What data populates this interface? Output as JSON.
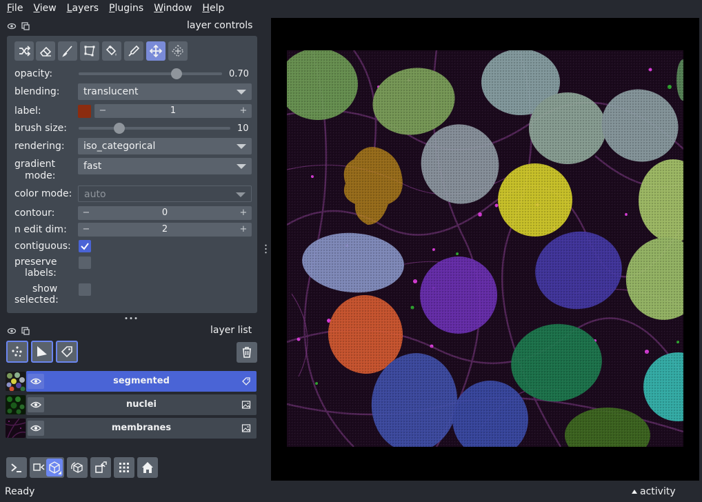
{
  "menu": [
    {
      "label": "File",
      "ul": "F",
      "rest": "ile"
    },
    {
      "label": "View",
      "ul": "V",
      "rest": "iew"
    },
    {
      "label": "Layers",
      "ul": "L",
      "rest": "ayers"
    },
    {
      "label": "Plugins",
      "ul": "P",
      "rest": "lugins"
    },
    {
      "label": "Window",
      "ul": "W",
      "rest": "indow"
    },
    {
      "label": "Help",
      "ul": "H",
      "rest": "elp"
    }
  ],
  "layer_controls": {
    "title": "layer controls",
    "mode_buttons": [
      "shuffle-icon",
      "eraser-icon",
      "paintbrush-icon",
      "polygon-icon",
      "fill-bucket-icon",
      "color-picker-icon",
      "pan-zoom-icon",
      "transform-icon"
    ],
    "active_mode": "pan-zoom-icon",
    "opacity": {
      "label": "opacity:",
      "value": "0.70",
      "fraction": 0.7
    },
    "blending": {
      "label": "blending:",
      "value": "translucent"
    },
    "label": {
      "label": "label:",
      "value": "1",
      "swatch_color": "#8b2c0f"
    },
    "brush_size": {
      "label": "brush size:",
      "value": "10",
      "fraction": 0.25
    },
    "rendering": {
      "label": "rendering:",
      "value": "iso_categorical"
    },
    "gradient_mode": {
      "label_line1": "gradient",
      "label_line2": "mode:",
      "value": "fast"
    },
    "color_mode": {
      "label": "color mode:",
      "value": "auto"
    },
    "contour": {
      "label": "contour:",
      "value": "0"
    },
    "n_edit_dim": {
      "label": "n edit dim:",
      "value": "2"
    },
    "contiguous": {
      "label": "contiguous:",
      "checked": true
    },
    "preserve_labels": {
      "label_line1": "preserve",
      "label_line2": "labels:",
      "checked": false
    },
    "show_selected": {
      "label_line1": "show",
      "label_line2": "selected:",
      "checked": false
    }
  },
  "layer_list": {
    "title": "layer list",
    "new_layer_buttons": [
      "new-points-icon",
      "new-shapes-icon",
      "new-labels-icon"
    ],
    "layers": [
      {
        "name": "segmented",
        "selected": true,
        "type_icon": "label-tag-icon"
      },
      {
        "name": "nuclei",
        "selected": false,
        "type_icon": "image-icon"
      },
      {
        "name": "membranes",
        "selected": false,
        "type_icon": "image-icon"
      }
    ]
  },
  "bottom_buttons": [
    "console-icon",
    "ndisplay-toggle-icon",
    "roll-dims-icon",
    "transpose-icon",
    "grid-icon",
    "home-icon"
  ],
  "status": "Ready",
  "activity": "activity",
  "colors": {
    "bg": "#262930",
    "panel": "#414851",
    "control": "#5a626c",
    "accent": "#4a64d6",
    "text": "#f0f1f2"
  }
}
